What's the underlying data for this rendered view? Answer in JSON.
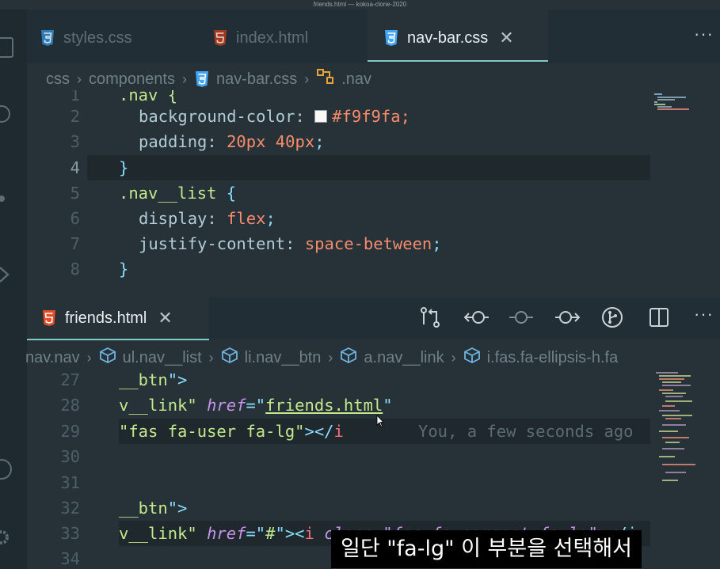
{
  "window_title": "friends.html — kokoa-clone-2020",
  "top_editor": {
    "tabs": [
      {
        "label": "styles.css",
        "icon": "css3-icon",
        "active": false
      },
      {
        "label": "index.html",
        "icon": "html5-icon",
        "active": false
      },
      {
        "label": "nav-bar.css",
        "icon": "css3-icon",
        "active": true
      }
    ],
    "close_glyph": "✕",
    "more_glyph": "···",
    "breadcrumb": [
      "css",
      "components",
      "nav-bar.css",
      ".nav"
    ],
    "line_numbers": [
      "1",
      "2",
      "3",
      "4",
      "5",
      "6",
      "7",
      "8"
    ],
    "code": {
      "l1": ".nav {",
      "l2_prop": "background-color:",
      "l2_val": "#f9f9fa;",
      "l3_prop": "padding:",
      "l3_val": "20px 40px",
      "l3_end": ";",
      "l4": "}",
      "l5_sel": ".nav__list",
      "l5_brace": " {",
      "l6_prop": "display:",
      "l6_val": "flex",
      "l6_end": ";",
      "l7_prop": "justify-content:",
      "l7_val": "space-between",
      "l7_end": ";",
      "l8": "}"
    }
  },
  "bottom_editor": {
    "tab_label": "friends.html",
    "close_glyph": "✕",
    "more_glyph": "···",
    "breadcrumb": [
      "nav.nav",
      "ul.nav__list",
      "li.nav__btn",
      "a.nav__link",
      "i.fas.fa-ellipsis-h.fa"
    ],
    "line_numbers": [
      "27",
      "28",
      "29",
      "30",
      "31",
      "32",
      "33",
      "34"
    ],
    "code": {
      "l27_a": "__btn",
      "l27_b": "\">",
      "l28_a": "v__link\" ",
      "l28_attr": "href",
      "l28_eq": "=\"",
      "l28_str": "friends.html",
      "l28_end": "\"",
      "l29_str": "\"fas fa-user fa-lg\"",
      "l29_tag": "></",
      "l29_i": "i",
      "l29_blame": "You, a few seconds ago",
      "l32_a": "__btn",
      "l32_b": "\">",
      "l33_a": "v__link\" ",
      "l33_attr": "href",
      "l33_eq": "=\"",
      "l33_str": "#",
      "l33_c": "\"><",
      "l33_i": "i",
      "l33_rest": " class=\"fas fa-comment fa-lg\"",
      "l33_tail": "></i"
    }
  },
  "subtitle": "일단 \"fa-lg\" 이 부분을 선택해서",
  "colors": {
    "background": "#263238",
    "tab_bar": "#222e35",
    "accent_underline": "#80cbc4",
    "css_icon": "#42a5f5",
    "html_icon": "#e44d26"
  }
}
